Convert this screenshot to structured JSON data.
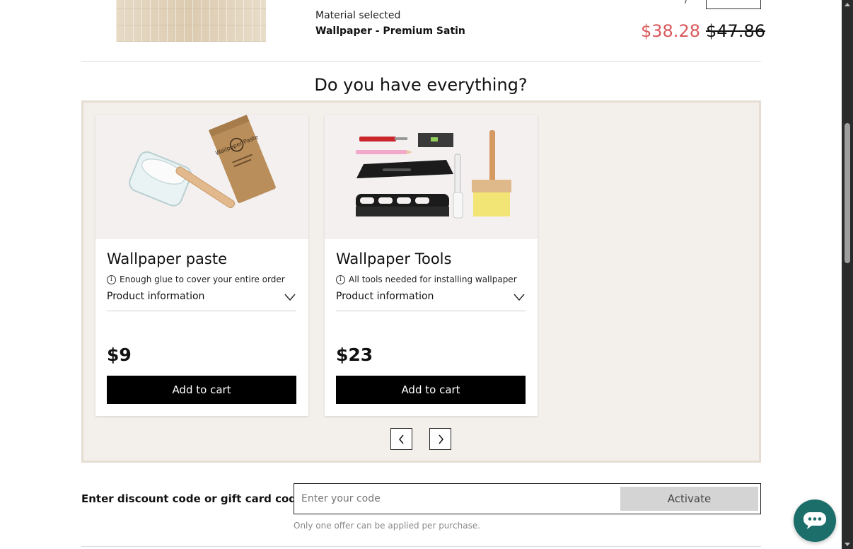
{
  "cart_item": {
    "material_label": "Material selected",
    "material_value": "Wallpaper - Premium Satin",
    "price_sale": "$38.28",
    "price_original": "$47.86"
  },
  "upsell": {
    "title": "Do you have everything?",
    "products": [
      {
        "name": "Wallpaper paste",
        "note": "Enough glue to cover your entire order",
        "info_label": "Product information",
        "price": "$9",
        "button_label": "Add to cart",
        "image_label": "Wallpaper Paste",
        "icon": "paste-image"
      },
      {
        "name": "Wallpaper Tools",
        "note": "All tools needed for installing wallpaper",
        "info_label": "Product information",
        "price": "$23",
        "button_label": "Add to cart",
        "icon": "tools-image"
      }
    ],
    "nav": {
      "prev_icon": "chevron-left-icon",
      "next_icon": "chevron-right-icon"
    }
  },
  "discount": {
    "label": "Enter discount code or gift card code",
    "placeholder": "Enter your code",
    "button_label": "Activate",
    "hint": "Only one offer can be applied per purchase."
  },
  "colors": {
    "sale_price": "#d9595c",
    "chat_button": "#1b6e6a",
    "upsell_bg": "#f3efeb",
    "button_black": "#000000",
    "activate_bg": "#d4d4d4"
  }
}
